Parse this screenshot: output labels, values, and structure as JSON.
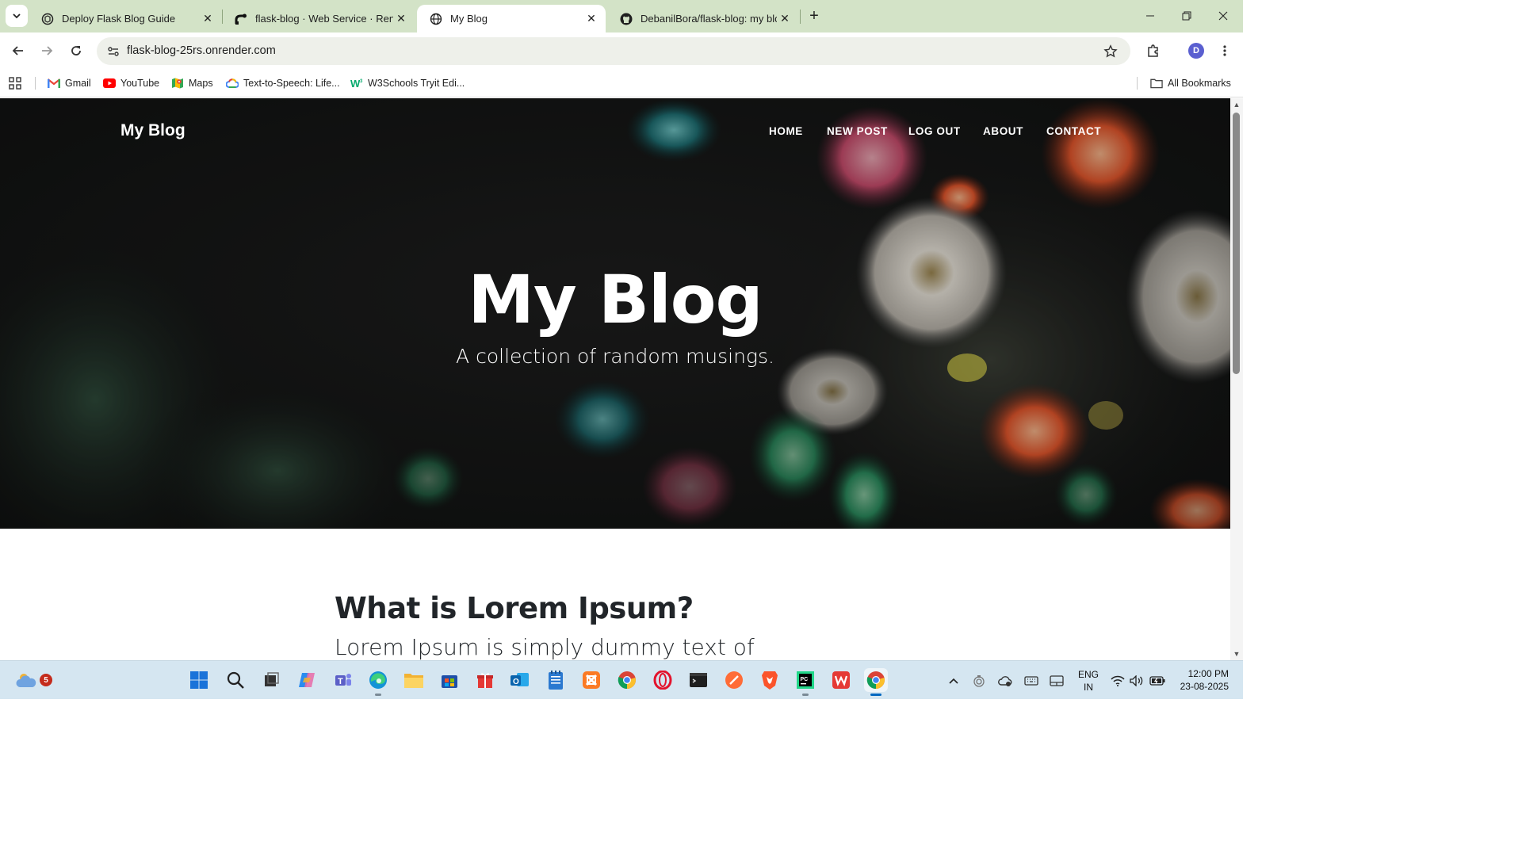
{
  "tabs": [
    {
      "title": "Deploy Flask Blog Guide",
      "icon": "chatgpt-icon"
    },
    {
      "title": "flask-blog · Web Service · Render",
      "icon": "render-icon"
    },
    {
      "title": "My Blog",
      "icon": "globe-icon",
      "active": true
    },
    {
      "title": "DebanilBora/flask-blog: my blog",
      "icon": "github-icon"
    }
  ],
  "addressbar": {
    "url": "flask-blog-25rs.onrender.com",
    "profile_initial": "D"
  },
  "bookmarks": {
    "items": [
      {
        "label": "Gmail",
        "icon": "gmail-icon"
      },
      {
        "label": "YouTube",
        "icon": "youtube-icon"
      },
      {
        "label": "Maps",
        "icon": "maps-icon"
      },
      {
        "label": "Text-to-Speech: Life...",
        "icon": "cloud-tts-icon"
      },
      {
        "label": "W3Schools Tryit Edi...",
        "icon": "w3schools-icon"
      }
    ],
    "all_label": "All Bookmarks"
  },
  "page": {
    "brand": "My Blog",
    "nav": [
      "HOME",
      "NEW POST",
      "LOG OUT",
      "ABOUT",
      "CONTACT"
    ],
    "hero_title": "My Blog",
    "hero_subtitle": "A collection of random musings.",
    "post_title": "What is Lorem Ipsum?",
    "post_subtitle": "Lorem Ipsum is simply dummy text of"
  },
  "taskbar": {
    "weather_badge": "5",
    "lang_line1": "ENG",
    "lang_line2": "IN",
    "time": "12:00 PM",
    "date": "23-08-2025"
  },
  "colors": {
    "tabstrip": "#d3e3c7",
    "hero_dark": "#161616",
    "taskbar": "#d5e6f1",
    "accent": "#0067c0"
  }
}
